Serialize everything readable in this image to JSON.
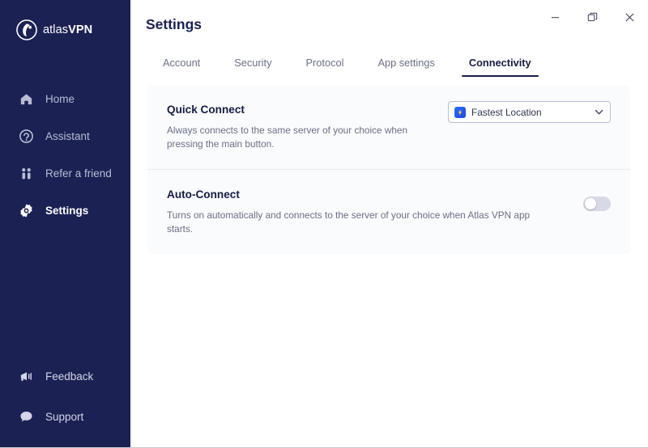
{
  "sidebar": {
    "brand": {
      "prefix": "atlas",
      "suffix": "VPN",
      "logo_icon": "atlas-shield-logo"
    },
    "items": [
      {
        "label": "Home",
        "icon": "home-icon",
        "active": false
      },
      {
        "label": "Assistant",
        "icon": "assistant-chat-icon",
        "active": false
      },
      {
        "label": "Refer a friend",
        "icon": "refer-friend-people-icon",
        "active": false
      },
      {
        "label": "Settings",
        "icon": "settings-gear-icon",
        "active": true
      }
    ],
    "bottom_items": [
      {
        "label": "Feedback",
        "icon": "megaphone-icon"
      },
      {
        "label": "Support",
        "icon": "chat-bubble-icon"
      }
    ]
  },
  "titlebar": {
    "minimize_icon": "minimize-icon",
    "maximize_icon": "restore-window-icon",
    "close_icon": "close-icon"
  },
  "page": {
    "title": "Settings",
    "tabs": [
      {
        "label": "Account",
        "active": false
      },
      {
        "label": "Security",
        "active": false
      },
      {
        "label": "Protocol",
        "active": false
      },
      {
        "label": "App settings",
        "active": false
      },
      {
        "label": "Connectivity",
        "active": true
      }
    ]
  },
  "quick_connect": {
    "title": "Quick Connect",
    "description": "Always connects to the same server of your choice when pressing the main button.",
    "select": {
      "value": "Fastest Location",
      "icon": "lightning-bolt-icon",
      "chevron_icon": "chevron-down-icon"
    }
  },
  "auto_connect": {
    "title": "Auto-Connect",
    "description": "Turns on automatically and connects to the server of your choice when Atlas VPN app starts.",
    "toggle": {
      "state": "off",
      "name": "auto-connect-toggle"
    }
  },
  "colors": {
    "sidebar_bg": "#1b2153",
    "accent": "#2b6ef6",
    "card_bg": "#fafbfd",
    "text_dark": "#171c42",
    "text_muted": "#6a6f86",
    "toggle_off": "#d7dae6"
  }
}
